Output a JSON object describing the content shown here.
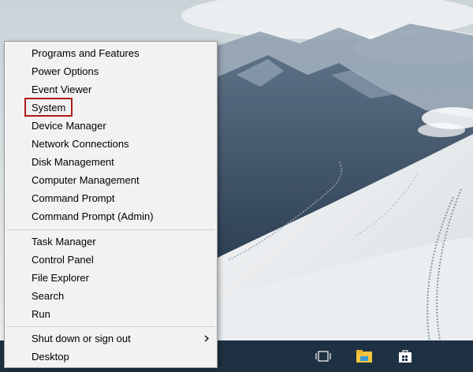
{
  "menu": {
    "group1": [
      {
        "label": "Programs and Features"
      },
      {
        "label": "Power Options"
      },
      {
        "label": "Event Viewer"
      },
      {
        "label": "System"
      },
      {
        "label": "Device Manager"
      },
      {
        "label": "Network Connections"
      },
      {
        "label": "Disk Management"
      },
      {
        "label": "Computer Management"
      },
      {
        "label": "Command Prompt"
      },
      {
        "label": "Command Prompt (Admin)"
      }
    ],
    "group2": [
      {
        "label": "Task Manager"
      },
      {
        "label": "Control Panel"
      },
      {
        "label": "File Explorer"
      },
      {
        "label": "Search"
      },
      {
        "label": "Run"
      }
    ],
    "group3": [
      {
        "label": "Shut down or sign out",
        "submenu_icon": "chevron-right-icon"
      },
      {
        "label": "Desktop"
      }
    ],
    "highlighted_item": "System",
    "highlight_color": "#b01b1b"
  },
  "taskbar": {
    "icons": [
      "task-view-icon",
      "file-explorer-icon",
      "store-icon"
    ],
    "color": "#1d3142"
  },
  "wallpaper": {
    "description_icon": "snowy-mountains-wallpaper"
  }
}
